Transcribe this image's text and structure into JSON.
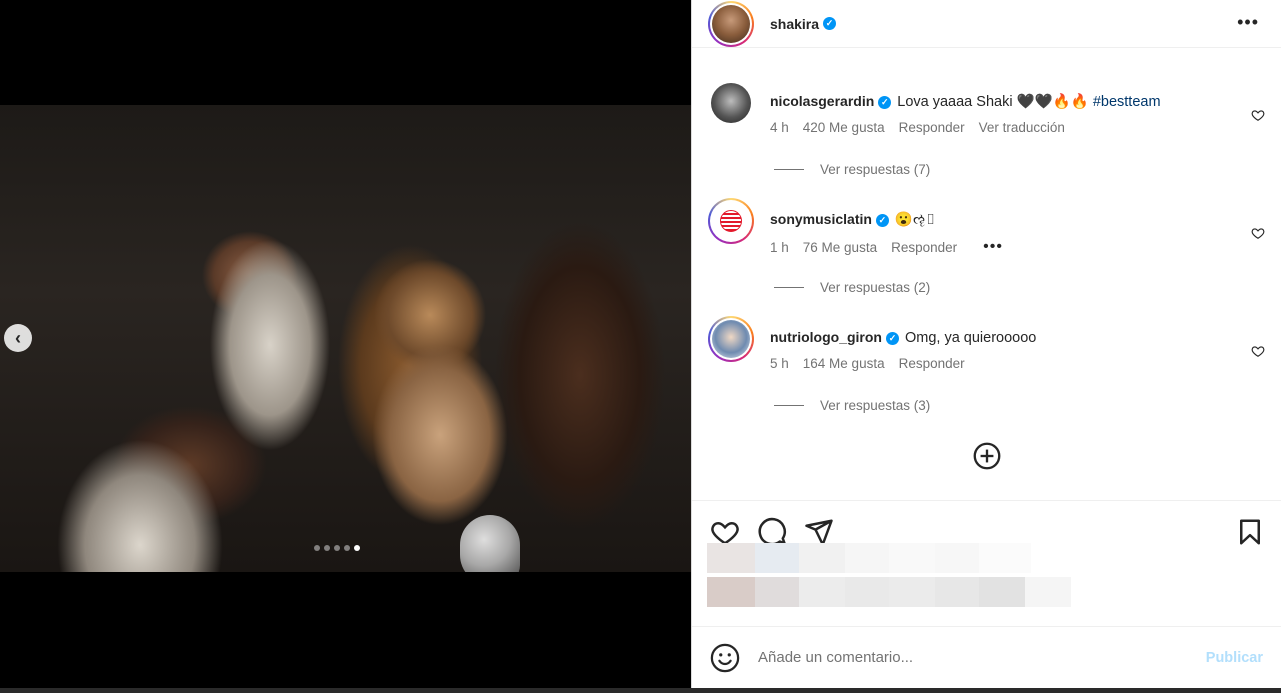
{
  "post": {
    "author": "shakira",
    "more_icon": "•••",
    "carousel": {
      "total_slides": 5,
      "active_slide": 5
    },
    "prev_icon": "‹"
  },
  "comments": [
    {
      "username": "nicolasgerardin",
      "text": "Lova yaaaa Shaki 🖤🖤🔥🔥",
      "hashtag": "#bestteam",
      "time": "4 h",
      "likes": "420 Me gusta",
      "reply": "Responder",
      "translate": "Ver traducción",
      "replies": "Ver respuestas (7)"
    },
    {
      "username": "sonymusiclatin",
      "text": "😮ૡ▯",
      "time": "1 h",
      "likes": "76 Me gusta",
      "reply": "Responder",
      "more": "•••",
      "replies": "Ver respuestas (2)"
    },
    {
      "username": "nutriologo_giron",
      "text": "Omg, ya quierooooo",
      "time": "5 h",
      "likes": "164 Me gusta",
      "reply": "Responder",
      "replies": "Ver respuestas (3)"
    }
  ],
  "composer": {
    "placeholder": "Añade un comentario...",
    "publish": "Publicar"
  },
  "colors": {
    "link": "#00376b",
    "verified": "#0095f6",
    "publish_disabled": "#b2dffc",
    "muted": "#737373"
  }
}
